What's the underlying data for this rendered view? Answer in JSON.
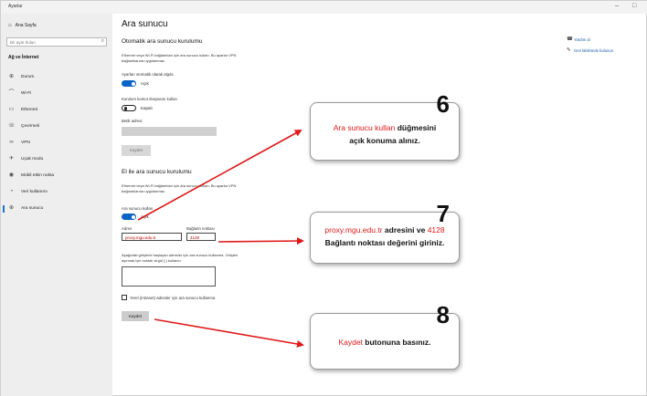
{
  "window": {
    "title": "Ayarlar",
    "minimize": "–",
    "restore": "□"
  },
  "sidebar": {
    "home": "Ana Sayfa",
    "search_placeholder": "Bir ayar bulun",
    "section": "Ağ ve İnternet",
    "items": [
      {
        "label": "Durum",
        "icon": "globe-icon"
      },
      {
        "label": "Wi-Fi",
        "icon": "wifi-icon"
      },
      {
        "label": "Ethernet",
        "icon": "ethernet-icon"
      },
      {
        "label": "Çevirmeli",
        "icon": "dialup-icon"
      },
      {
        "label": "VPN",
        "icon": "vpn-icon"
      },
      {
        "label": "Uçak modu",
        "icon": "airplane-icon"
      },
      {
        "label": "Mobil etkin nokta",
        "icon": "hotspot-icon"
      },
      {
        "label": "Veri kullanımı",
        "icon": "data-usage-icon"
      },
      {
        "label": "Ara sunucu",
        "icon": "proxy-icon"
      }
    ]
  },
  "main": {
    "title": "Ara sunucu",
    "auto": {
      "heading": "Otomatik ara sunucu kurulumu",
      "desc_line1": "Ethernet veya Wi-Fi bağlantıları için ara sunucu kullan. Bu ayarlar VPN",
      "desc_line2": "bağlantılarına uygulanmaz.",
      "detect_label": "Ayarları otomatik olarak algıla",
      "detect_state": "Açık",
      "script_label": "Kurulum komut dosyasını kullan",
      "script_state": "Kapalı",
      "address_label": "Betik adresi",
      "save_label": "Kaydet"
    },
    "manual": {
      "heading": "El ile ara sunucu kurulumu",
      "desc_line1": "Ethernet veya Wi-Fi bağlantıları için ara sunucu kullan. Bu ayarlar VPN",
      "desc_line2": "bağlantılarına uygulanmaz.",
      "use_proxy_label": "Ara sunucu kullan",
      "use_proxy_state": "Açık",
      "address_label": "Adres",
      "address_value": "proxy.mgu.edu.tr",
      "port_label": "Bağlantı noktası",
      "port_value": "4128",
      "exceptions_line1": "Aşağıdaki girişlerle başlayan adresler için ara sunucu kullanma. Girişleri",
      "exceptions_line2": "ayırmak için noktalı virgül (;) kullanın.",
      "local_label": "Yerel (intranet) adresler için ara sunucu kullanma",
      "save_label": "Kaydet"
    }
  },
  "related": {
    "help": "Yardım al",
    "feedback": "Geri bildirimde bulunun"
  },
  "callouts": [
    {
      "number": "6",
      "red": "Ara sunucu kullan",
      "rest": " düğmesini",
      "line2": "açık konuma alınız."
    },
    {
      "number": "7",
      "red1": "proxy.mgu.edu.tr",
      "mid": " adresini ve ",
      "red2": "4128",
      "line2": "Bağlantı noktası değerini giriniz."
    },
    {
      "number": "8",
      "red": "Kaydet",
      "rest": " butonuna basınız."
    }
  ],
  "colors": {
    "accent": "#0b63c5",
    "annotation_red": "#e01818",
    "link": "#1a5ca8"
  }
}
